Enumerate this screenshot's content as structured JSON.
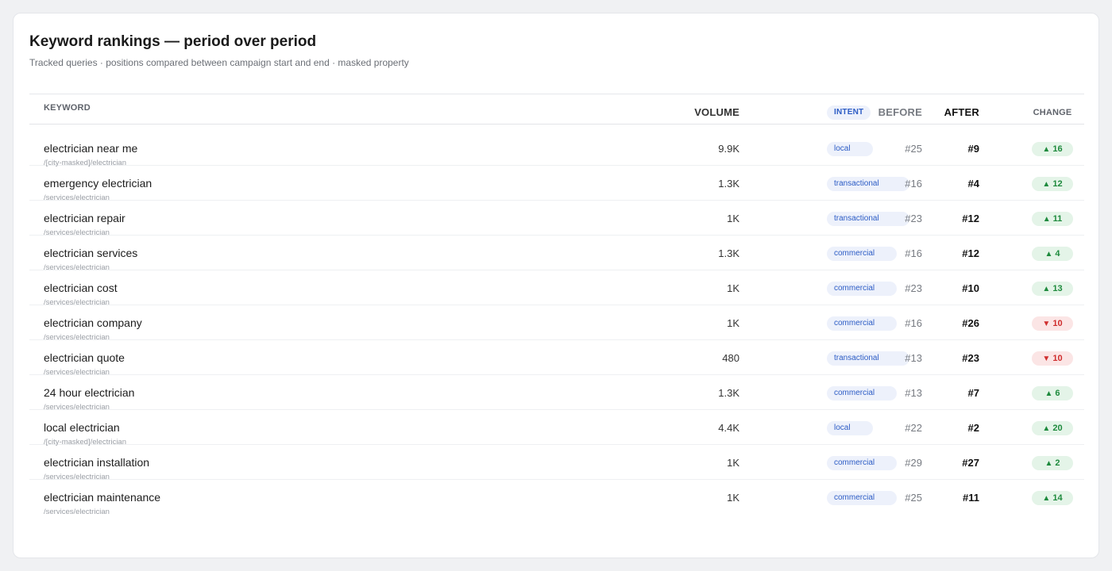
{
  "header": {
    "title": "Keyword rankings — period over period",
    "subtitle": "Tracked queries · positions compared between campaign start and end · masked property"
  },
  "columns": {
    "keyword": "KEYWORD",
    "volume": "VOLUME",
    "intent": "INTENT",
    "before": "BEFORE",
    "after": "AFTER",
    "change": "CHANGE"
  },
  "colors": {
    "up": "#1e8a3d",
    "down": "#cf2e2e",
    "intent": "#2c5cc5"
  },
  "rows": [
    {
      "keyword": "electrician near me",
      "path": "/[city-masked]/electrician",
      "volume": "9.9K",
      "intent": "local",
      "before": "#25",
      "after": "#9",
      "direction": "up",
      "arrow": "▲",
      "change": "16"
    },
    {
      "keyword": "emergency electrician",
      "path": "/services/electrician",
      "volume": "1.3K",
      "intent": "transactional",
      "before": "#16",
      "after": "#4",
      "direction": "up",
      "arrow": "▲",
      "change": "12"
    },
    {
      "keyword": "electrician repair",
      "path": "/services/electrician",
      "volume": "1K",
      "intent": "transactional",
      "before": "#23",
      "after": "#12",
      "direction": "up",
      "arrow": "▲",
      "change": "11"
    },
    {
      "keyword": "electrician services",
      "path": "/services/electrician",
      "volume": "1.3K",
      "intent": "commercial",
      "before": "#16",
      "after": "#12",
      "direction": "up",
      "arrow": "▲",
      "change": "4"
    },
    {
      "keyword": "electrician cost",
      "path": "/services/electrician",
      "volume": "1K",
      "intent": "commercial",
      "before": "#23",
      "after": "#10",
      "direction": "up",
      "arrow": "▲",
      "change": "13"
    },
    {
      "keyword": "electrician company",
      "path": "/services/electrician",
      "volume": "1K",
      "intent": "commercial",
      "before": "#16",
      "after": "#26",
      "direction": "down",
      "arrow": "▼",
      "change": "10"
    },
    {
      "keyword": "electrician quote",
      "path": "/services/electrician",
      "volume": "480",
      "intent": "transactional",
      "before": "#13",
      "after": "#23",
      "direction": "down",
      "arrow": "▼",
      "change": "10"
    },
    {
      "keyword": "24 hour electrician",
      "path": "/services/electrician",
      "volume": "1.3K",
      "intent": "commercial",
      "before": "#13",
      "after": "#7",
      "direction": "up",
      "arrow": "▲",
      "change": "6"
    },
    {
      "keyword": "local electrician",
      "path": "/[city-masked]/electrician",
      "volume": "4.4K",
      "intent": "local",
      "before": "#22",
      "after": "#2",
      "direction": "up",
      "arrow": "▲",
      "change": "20"
    },
    {
      "keyword": "electrician installation",
      "path": "/services/electrician",
      "volume": "1K",
      "intent": "commercial",
      "before": "#29",
      "after": "#27",
      "direction": "up",
      "arrow": "▲",
      "change": "2"
    },
    {
      "keyword": "electrician maintenance",
      "path": "/services/electrician",
      "volume": "1K",
      "intent": "commercial",
      "before": "#25",
      "after": "#11",
      "direction": "up",
      "arrow": "▲",
      "change": "14"
    }
  ]
}
